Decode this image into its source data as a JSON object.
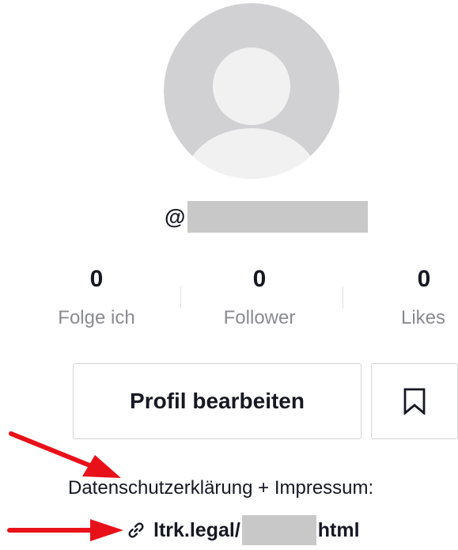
{
  "profile": {
    "username_prefix": "@"
  },
  "stats": [
    {
      "value": "0",
      "label": "Folge ich"
    },
    {
      "value": "0",
      "label": "Follower"
    },
    {
      "value": "0",
      "label": "Likes"
    }
  ],
  "actions": {
    "edit_profile_label": "Profil bearbeiten",
    "bookmark_icon": "bookmark-icon"
  },
  "bio": {
    "text": "Datenschutzerklärung + Impressum:",
    "link_prefix": "ltrk.legal/",
    "link_suffix": "html",
    "link_icon": "link-icon"
  },
  "annotations": {
    "arrow_color": "#e8111a"
  },
  "colors": {
    "avatar_bg": "#d1d1d3",
    "avatar_figure": "#f1f1f2",
    "text_primary": "#161823",
    "text_secondary": "#8a8b91",
    "redaction": "#c8c8c8"
  }
}
